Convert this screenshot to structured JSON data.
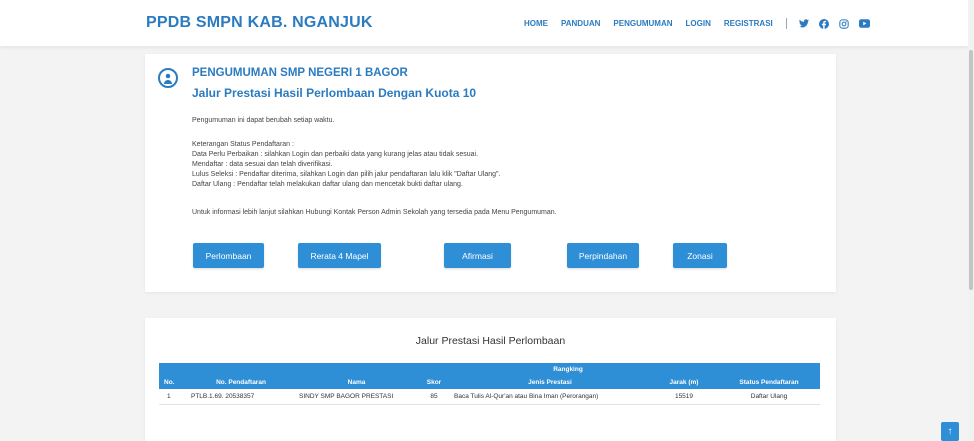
{
  "header": {
    "brand": "PPDB SMPN KAB. NGANJUK",
    "nav": [
      "HOME",
      "PANDUAN",
      "PENGUMUMAN",
      "LOGIN",
      "REGISTRASI"
    ],
    "social_icons": [
      "twitter-icon",
      "facebook-icon",
      "instagram-icon",
      "youtube-icon"
    ]
  },
  "announcement": {
    "title": "PENGUMUMAN SMP NEGERI 1 BAGOR",
    "subtitle": "Jalur Prestasi Hasil Perlombaan Dengan Kuota 10",
    "notice": "Pengumuman ini dapat berubah setiap waktu.",
    "status_heading": "Keterangan Status Pendaftaran :",
    "status_lines": [
      "Data Perlu Perbaikan : silahkan Login dan perbaiki data yang kurang jelas atau tidak sesuai.",
      "Mendaftar : data sesuai dan telah diverifikasi.",
      "Lulus Seleksi : Pendaftar diterima, silahkan Login dan pilih jalur pendaftaran lalu klik \"Daftar Ulang\".",
      "Daftar Ulang : Pendaftar telah melakukan daftar ulang dan mencetak bukti daftar ulang."
    ],
    "contact": "Untuk informasi lebih lanjut silahkan Hubungi Kontak Person Admin Sekolah yang tersedia pada Menu Pengumuman."
  },
  "buttons": [
    "Perlombaan",
    "Rerata 4 Mapel",
    "Afirmasi",
    "Perpindahan",
    "Zonasi"
  ],
  "table": {
    "title": "Jalur Prestasi Hasil Perlombaan",
    "group_header": "Rangking",
    "headers": [
      "No.",
      "No. Pendaftaran",
      "Nama",
      "Skor",
      "Jenis Prestasi",
      "Jarak (m)",
      "Status Pendaftaran"
    ],
    "rows": [
      [
        "1",
        "PTLB.1.69. 20538357",
        "SINDY SMP BAGOR PRESTASI",
        "85",
        "Baca Tulis Al-Qur'an atau Bina Iman (Perorangan)",
        "15519",
        "Daftar Ulang"
      ]
    ]
  },
  "colors": {
    "primary": "#2b7bc0",
    "button": "#2e8ed6"
  }
}
